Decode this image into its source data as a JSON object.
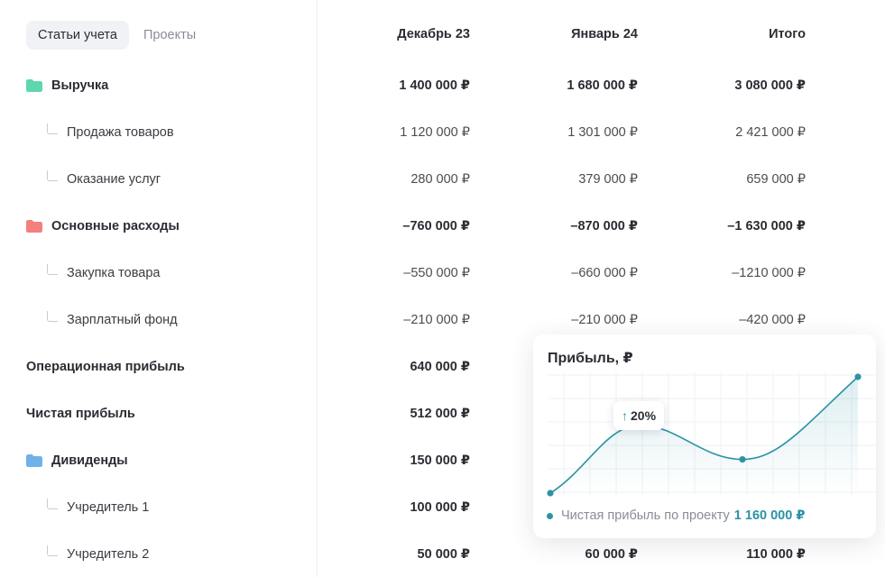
{
  "tabs": {
    "active": "Статьи учета",
    "inactive": "Проекты"
  },
  "columns": [
    "Декабрь 23",
    "Январь 24",
    "Итого"
  ],
  "rows": [
    {
      "label": "Выручка",
      "values": [
        "1 400 000 ₽",
        "1 680 000 ₽",
        "3 080 000 ₽"
      ]
    },
    {
      "label": "Продажа товаров",
      "values": [
        "1 120 000 ₽",
        "1 301 000 ₽",
        "2 421 000 ₽"
      ]
    },
    {
      "label": "Оказание услуг",
      "values": [
        "280 000 ₽",
        "379 000 ₽",
        "659 000 ₽"
      ]
    },
    {
      "label": "Основные расходы",
      "values": [
        "–760 000 ₽",
        "–870 000 ₽",
        "–1 630 000 ₽"
      ]
    },
    {
      "label": "Закупка товара",
      "values": [
        "–550 000 ₽",
        "–660 000 ₽",
        "–1210 000 ₽"
      ]
    },
    {
      "label": "Зарплатный фонд",
      "values": [
        "–210 000 ₽",
        "–210 000 ₽",
        "–420 000 ₽"
      ]
    },
    {
      "label": "Операционная прибыль",
      "values": [
        "640 000 ₽"
      ]
    },
    {
      "label": "Чистая прибыль",
      "values": [
        "512 000 ₽"
      ]
    },
    {
      "label": "Дивиденды",
      "values": [
        "150 000 ₽"
      ]
    },
    {
      "label": "Учредитель 1",
      "values": [
        "100 000 ₽"
      ]
    },
    {
      "label": "Учредитель 2",
      "values": [
        "50 000 ₽",
        "60 000 ₽",
        "110 000 ₽"
      ]
    }
  ],
  "colors": {
    "revenue_folder": "#5fd6b0",
    "expense_folder": "#f47f7f",
    "dividend_folder": "#6fb1e8",
    "accent": "#2a93a5"
  },
  "icons": {
    "revenue": "folder-icon",
    "expenses": "folder-icon",
    "dividends": "folder-icon",
    "child": "tree-branch-icon"
  },
  "widget": {
    "title": "Прибыль, ₽",
    "badge": "20%",
    "badge_icon": "arrow-up-icon",
    "legend_label": "Чистая прибыль по проекту",
    "legend_value": "1 160 000 ₽"
  },
  "chart_data": {
    "type": "line",
    "title": "Прибыль, ₽",
    "series": [
      {
        "name": "Чистая прибыль по проекту",
        "values": [
          0.0,
          0.58,
          0.29,
          1.0
        ]
      }
    ],
    "grid": true,
    "smooth": true,
    "annotation": "↑20%"
  }
}
